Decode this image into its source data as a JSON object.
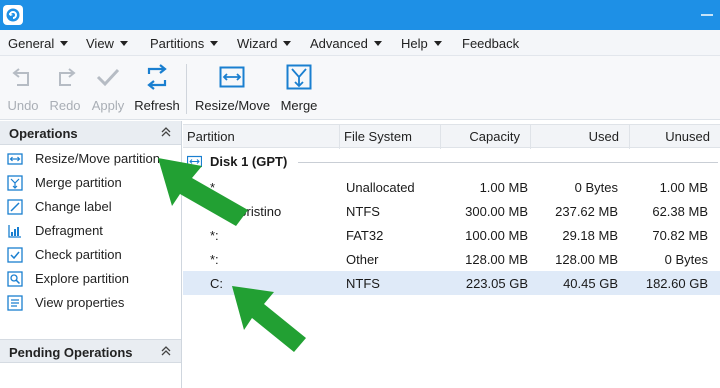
{
  "menubar": {
    "items": [
      "General",
      "View",
      "Partitions",
      "Wizard",
      "Advanced",
      "Help",
      "Feedback"
    ]
  },
  "toolbar": {
    "buttons": [
      {
        "label": "Undo",
        "icon": "undo-icon",
        "enabled": false
      },
      {
        "label": "Redo",
        "icon": "redo-icon",
        "enabled": false
      },
      {
        "label": "Apply",
        "icon": "apply-check-icon",
        "enabled": false
      },
      {
        "label": "Refresh",
        "icon": "refresh-icon",
        "enabled": true
      },
      {
        "label": "Resize/Move",
        "icon": "resize-move-icon",
        "enabled": true
      },
      {
        "label": "Merge",
        "icon": "merge-icon",
        "enabled": true
      }
    ]
  },
  "operations": {
    "title": "Operations",
    "items": [
      {
        "label": "Resize/Move partition",
        "icon": "resize-move-icon"
      },
      {
        "label": "Merge partition",
        "icon": "merge-icon"
      },
      {
        "label": "Change label",
        "icon": "edit-label-icon"
      },
      {
        "label": "Defragment",
        "icon": "defragment-icon"
      },
      {
        "label": "Check partition",
        "icon": "check-icon"
      },
      {
        "label": "Explore partition",
        "icon": "explore-icon"
      },
      {
        "label": "View properties",
        "icon": "properties-icon"
      }
    ]
  },
  "pending": {
    "title": "Pending Operations"
  },
  "table": {
    "columns": [
      "Partition",
      "File System",
      "Capacity",
      "Used",
      "Unused"
    ],
    "disk_label": "Disk 1 (GPT)",
    "rows": [
      {
        "partition": "*",
        "fs": "Unallocated",
        "capacity": "1.00 MB",
        "used": "0 Bytes",
        "unused": "1.00 MB"
      },
      {
        "partition": "Ripristino",
        "fs": "NTFS",
        "capacity": "300.00 MB",
        "used": "237.62 MB",
        "unused": "62.38 MB"
      },
      {
        "partition": "*:",
        "fs": "FAT32",
        "capacity": "100.00 MB",
        "used": "29.18 MB",
        "unused": "70.82 MB"
      },
      {
        "partition": "*:",
        "fs": "Other",
        "capacity": "128.00 MB",
        "used": "128.00 MB",
        "unused": "0 Bytes"
      },
      {
        "partition": "C:",
        "fs": "NTFS",
        "capacity": "223.05 GB",
        "used": "40.45 GB",
        "unused": "182.60 GB"
      }
    ]
  },
  "colors": {
    "titlebar": "#1e90e6",
    "accent_icon": "#1a7fd0",
    "arrow": "#22a033",
    "selected_row": "#dfeaf8"
  }
}
